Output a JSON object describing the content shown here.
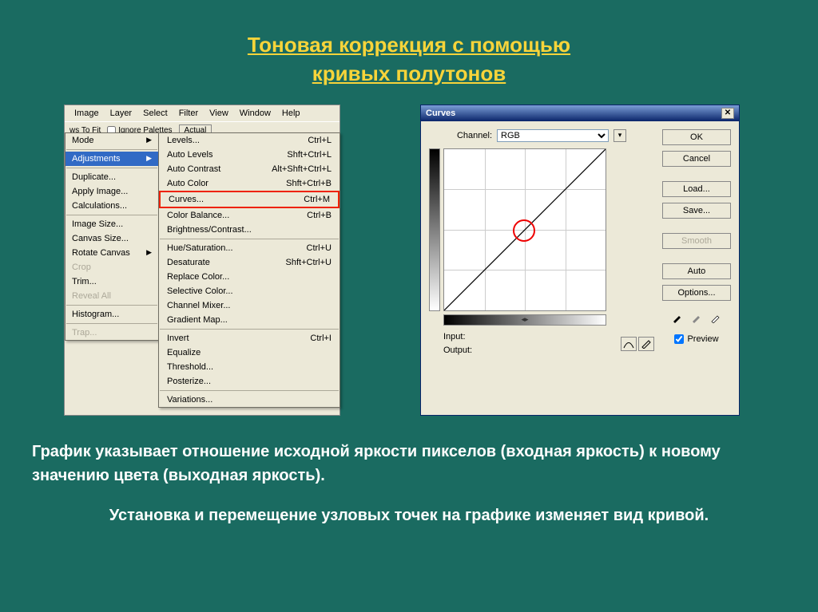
{
  "title_line1": "Тоновая коррекция с помощью",
  "title_line2": "кривых полутонов",
  "menubar": [
    "Image",
    "Layer",
    "Select",
    "Filter",
    "View",
    "Window",
    "Help"
  ],
  "toolbar": {
    "fit": "ws To Fit",
    "ignore": "Ignore Palettes",
    "actual": "Actual"
  },
  "image_menu": {
    "mode": "Mode",
    "adjust": "Adjustments",
    "dup": "Duplicate...",
    "apply": "Apply Image...",
    "calc": "Calculations...",
    "isize": "Image Size...",
    "csize": "Canvas Size...",
    "rot": "Rotate Canvas",
    "crop": "Crop",
    "trim": "Trim...",
    "reveal": "Reveal All",
    "hist": "Histogram...",
    "trap": "Trap..."
  },
  "adjust_menu": [
    {
      "l": "Levels...",
      "s": "Ctrl+L"
    },
    {
      "l": "Auto Levels",
      "s": "Shft+Ctrl+L"
    },
    {
      "l": "Auto Contrast",
      "s": "Alt+Shft+Ctrl+L"
    },
    {
      "l": "Auto Color",
      "s": "Shft+Ctrl+B"
    },
    {
      "l": "Curves...",
      "s": "Ctrl+M",
      "hi": true
    },
    {
      "l": "Color Balance...",
      "s": "Ctrl+B"
    },
    {
      "l": "Brightness/Contrast...",
      "s": ""
    },
    {
      "sep": true
    },
    {
      "l": "Hue/Saturation...",
      "s": "Ctrl+U"
    },
    {
      "l": "Desaturate",
      "s": "Shft+Ctrl+U"
    },
    {
      "l": "Replace Color...",
      "s": ""
    },
    {
      "l": "Selective Color...",
      "s": ""
    },
    {
      "l": "Channel Mixer...",
      "s": ""
    },
    {
      "l": "Gradient Map...",
      "s": ""
    },
    {
      "sep": true
    },
    {
      "l": "Invert",
      "s": "Ctrl+I"
    },
    {
      "l": "Equalize",
      "s": ""
    },
    {
      "l": "Threshold...",
      "s": ""
    },
    {
      "l": "Posterize...",
      "s": ""
    },
    {
      "sep": true
    },
    {
      "l": "Variations...",
      "s": ""
    }
  ],
  "curves": {
    "title": "Curves",
    "channel_label": "Channel:",
    "channel_value": "RGB",
    "input": "Input:",
    "output": "Output:",
    "ok": "OK",
    "cancel": "Cancel",
    "load": "Load...",
    "save": "Save...",
    "smooth": "Smooth",
    "auto": "Auto",
    "options": "Options...",
    "preview": "Preview"
  },
  "body_p1": "График указывает отношение исходной яркости пикселов (входная яркость) к новому значению цвета (выходная яркость).",
  "body_p2": "Установка и перемещение узловых точек на графике изменяет вид кривой."
}
